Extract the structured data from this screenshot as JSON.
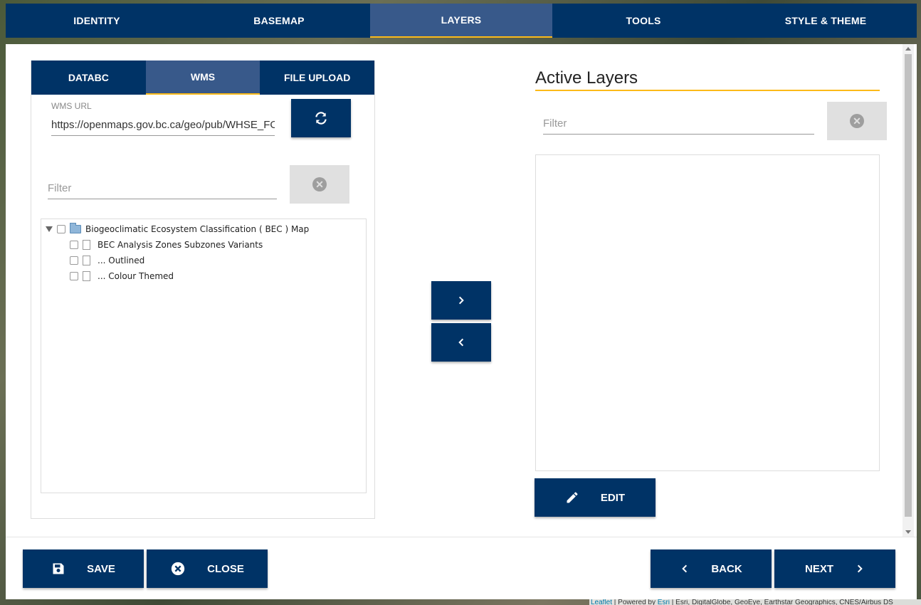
{
  "topnav": {
    "tabs": [
      {
        "label": "IDENTITY"
      },
      {
        "label": "BASEMAP"
      },
      {
        "label": "LAYERS"
      },
      {
        "label": "TOOLS"
      },
      {
        "label": "STYLE & THEME"
      }
    ],
    "active_index": 2
  },
  "left": {
    "subtabs": [
      {
        "label": "DATABC"
      },
      {
        "label": "WMS"
      },
      {
        "label": "FILE UPLOAD"
      }
    ],
    "active_index": 1,
    "wms_url": {
      "label": "WMS URL",
      "value": "https://openmaps.gov.bc.ca/geo/pub/WHSE_FOREST_VEGETATION.BEC_BIOGEOCLIMATIC_POLY/ows"
    },
    "filter": {
      "placeholder": "Filter"
    },
    "tree": {
      "root": "Biogeoclimatic Ecosystem Classification ( BEC ) Map",
      "children": [
        "BEC Analysis Zones Subzones Variants",
        "... Outlined",
        "... Colour Themed"
      ]
    }
  },
  "right": {
    "title": "Active Layers",
    "filter": {
      "placeholder": "Filter"
    },
    "edit_label": "EDIT"
  },
  "footer": {
    "save_label": "SAVE",
    "close_label": "CLOSE",
    "back_label": "BACK",
    "next_label": "NEXT"
  },
  "attribution": {
    "leaflet": "Leaflet",
    "powered": " | Powered by ",
    "esri": "Esri",
    "sources": " | Esri, DigitalGlobe, GeoEye, Earthstar Geographics, CNES/Airbus DS"
  },
  "colors": {
    "primary": "#003366",
    "active_tab": "#38598a",
    "accent": "#fcba19",
    "grey_button": "#e0e0e0"
  },
  "icons": {
    "refresh": "refresh-icon",
    "clear": "clear-circle-icon",
    "chevron_right": "chevron-right-icon",
    "chevron_left": "chevron-left-icon",
    "edit": "pencil-icon",
    "save": "floppy-disk-icon",
    "close": "close-circle-icon"
  }
}
